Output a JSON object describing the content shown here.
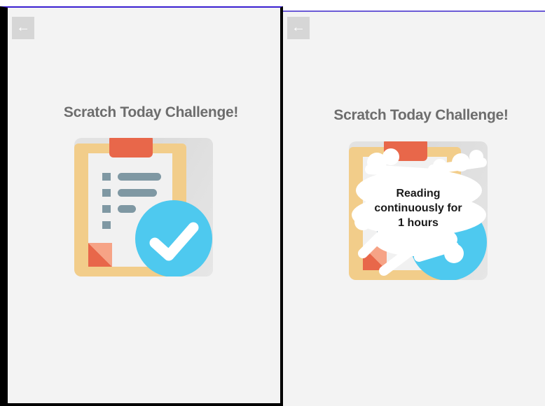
{
  "screens": [
    {
      "name": "before-scratch",
      "back_icon": "arrow-left-icon",
      "title": "Scratch Today Challenge!",
      "card_icon": "clipboard-check-icon"
    },
    {
      "name": "after-scratch",
      "back_icon": "arrow-left-icon",
      "title": "Scratch Today Challenge!",
      "card_icon": "clipboard-check-icon",
      "revealed_text": [
        "Reading",
        "continuously for",
        "1 hours"
      ]
    }
  ],
  "colors": {
    "background": "#f3f3f3",
    "title": "#6d6d6d",
    "clipboard_board": "#f2cd8a",
    "clipboard_clip": "#e8674a",
    "paper": "#f1f1f1",
    "list_bars": "#7f98a3",
    "check_circle": "#4ec9ef",
    "scratch_cover": "#ffffff"
  }
}
